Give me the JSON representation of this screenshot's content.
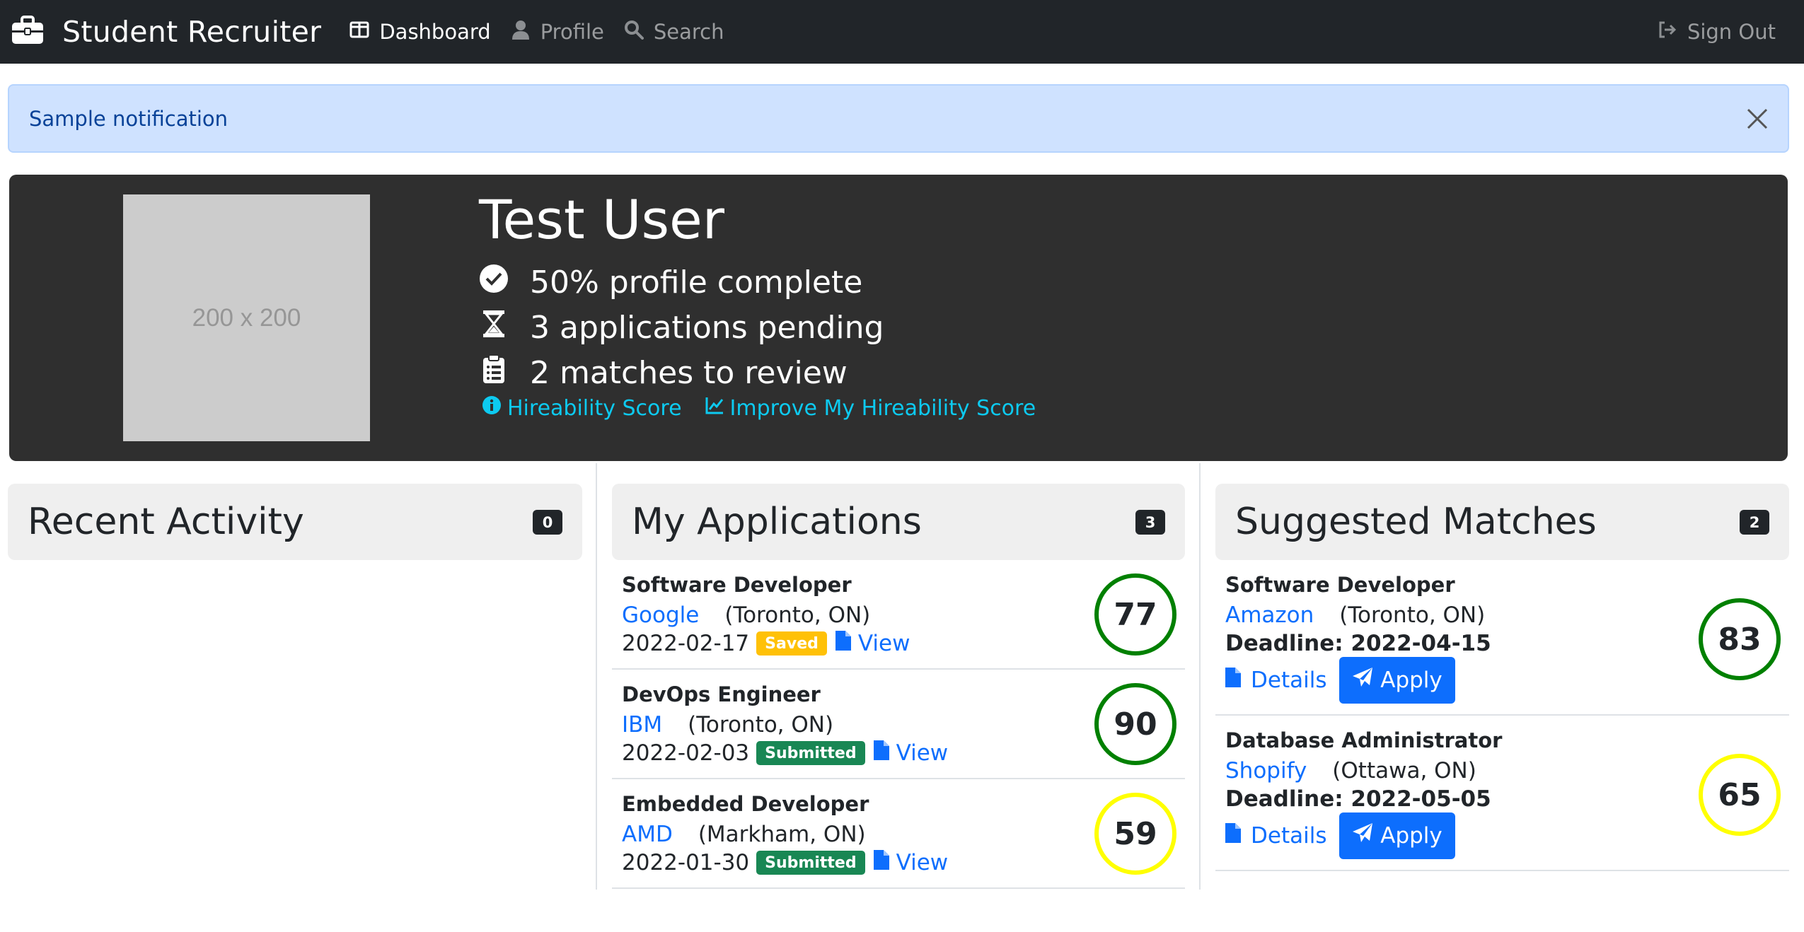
{
  "app": {
    "title": "Student Recruiter"
  },
  "nav": {
    "items": [
      {
        "label": "Dashboard",
        "icon": "dashboard-icon",
        "active": true
      },
      {
        "label": "Profile",
        "icon": "user-icon",
        "active": false
      },
      {
        "label": "Search",
        "icon": "search-icon",
        "active": false
      }
    ],
    "signout": "Sign Out"
  },
  "alert": {
    "text": "Sample notification"
  },
  "profile": {
    "avatar_placeholder": "200 x 200",
    "name": "Test User",
    "stats": [
      "50% profile complete",
      "3 applications pending",
      "2 matches to review"
    ],
    "links": [
      "Hireability Score",
      "Improve My Hireability Score"
    ]
  },
  "recent": {
    "title": "Recent Activity",
    "count": "0"
  },
  "applications": {
    "title": "My Applications",
    "count": "3",
    "items": [
      {
        "title": "Software Developer",
        "company": "Google",
        "location": "(Toronto, ON)",
        "date": "2022-02-17",
        "status": "Saved",
        "action": "View",
        "score": "77",
        "score_color": "#008000"
      },
      {
        "title": "DevOps Engineer",
        "company": "IBM",
        "location": "(Toronto, ON)",
        "date": "2022-02-03",
        "status": "Submitted",
        "action": "View",
        "score": "90",
        "score_color": "#008000"
      },
      {
        "title": "Embedded Developer",
        "company": "AMD",
        "location": "(Markham, ON)",
        "date": "2022-01-30",
        "status": "Submitted",
        "action": "View",
        "score": "59",
        "score_color": "#ffff00"
      }
    ]
  },
  "matches": {
    "title": "Suggested Matches",
    "count": "2",
    "items": [
      {
        "title": "Software Developer",
        "company": "Amazon",
        "location": "(Toronto, ON)",
        "deadline": "Deadline: 2022-04-15",
        "details": "Details",
        "apply": "Apply",
        "score": "83",
        "score_color": "#008000"
      },
      {
        "title": "Database Administrator",
        "company": "Shopify",
        "location": "(Ottawa, ON)",
        "deadline": "Deadline: 2022-05-05",
        "details": "Details",
        "apply": "Apply",
        "score": "65",
        "score_color": "#ffff00"
      }
    ]
  },
  "colors": {
    "navbar": "#212529",
    "hero": "#2f2f2f",
    "accent_link": "#0dcaf0",
    "primary": "#0d6efd",
    "saved_badge": "#ffc107",
    "submitted_badge": "#198754"
  }
}
